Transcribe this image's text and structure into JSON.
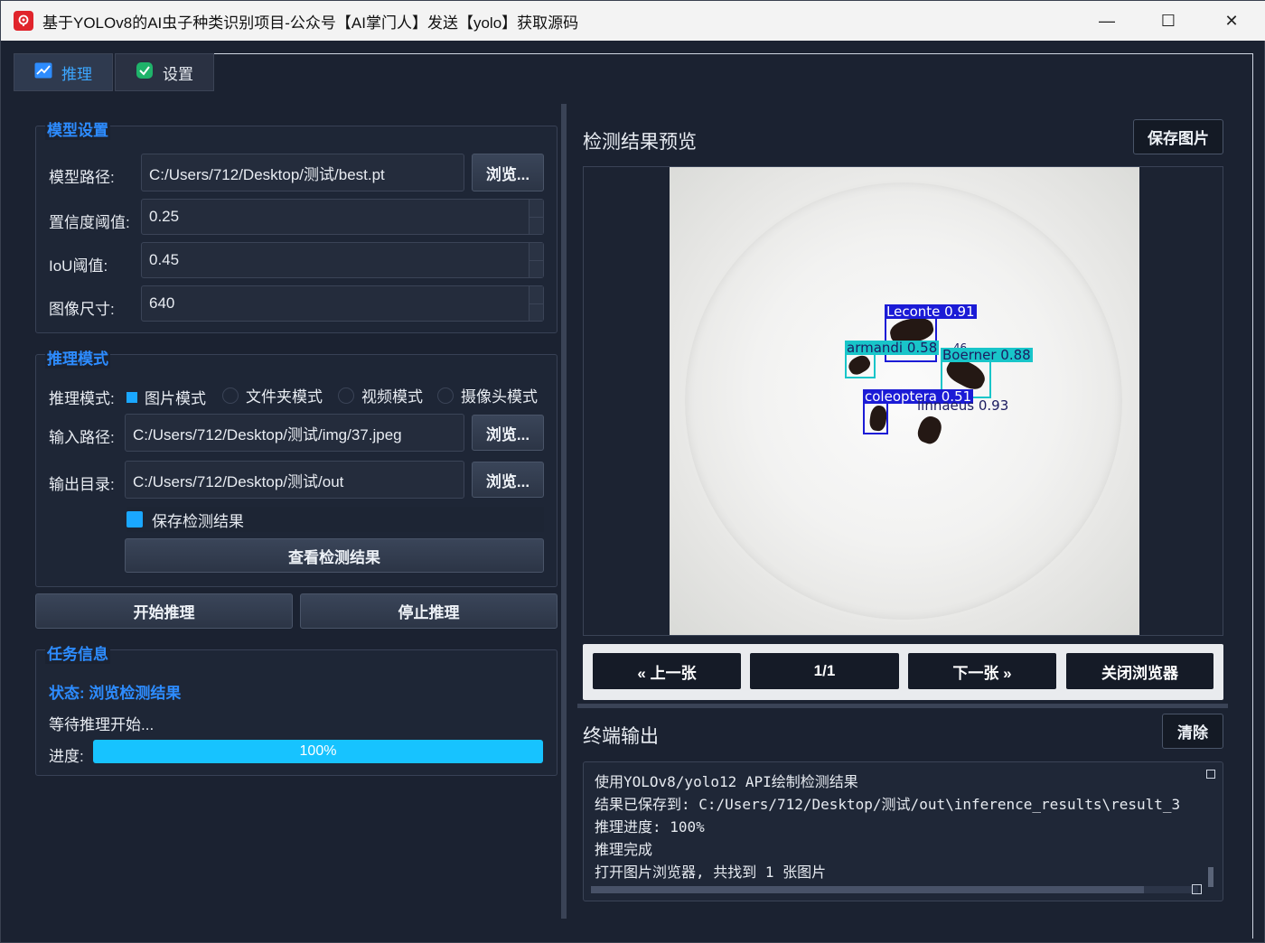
{
  "window": {
    "title": "基于YOLOv8的AI虫子种类识别项目-公众号【AI掌门人】发送【yolo】获取源码",
    "minimize_glyph": "—",
    "maximize_glyph": "☐",
    "close_glyph": "✕"
  },
  "tabs": [
    {
      "label": "推理",
      "icon": "chart-line-icon",
      "active": true
    },
    {
      "label": "设置",
      "icon": "check-shield-icon",
      "active": false
    }
  ],
  "model_settings": {
    "title": "模型设置",
    "model_path_label": "模型路径:",
    "model_path_value": "C:/Users/712/Desktop/测试/best.pt",
    "browse_label": "浏览...",
    "confidence_label": "置信度阈值:",
    "confidence_value": "0.25",
    "iou_label": "IoU阈值:",
    "iou_value": "0.45",
    "imgsz_label": "图像尺寸:",
    "imgsz_value": "640"
  },
  "inference_mode": {
    "title": "推理模式",
    "mode_label": "推理模式:",
    "options": [
      {
        "label": "图片模式",
        "selected": true
      },
      {
        "label": "文件夹模式",
        "selected": false
      },
      {
        "label": "视频模式",
        "selected": false
      },
      {
        "label": "摄像头模式",
        "selected": false
      }
    ],
    "input_label": "输入路径:",
    "input_value": "C:/Users/712/Desktop/测试/img/37.jpeg",
    "output_label": "输出目录:",
    "output_value": "C:/Users/712/Desktop/测试/out",
    "browse_label": "浏览...",
    "save_results_label": "保存检测结果",
    "save_results_checked": true,
    "view_results_label": "查看检测结果"
  },
  "actions": {
    "start_label": "开始推理",
    "stop_label": "停止推理"
  },
  "task_info": {
    "title": "任务信息",
    "status": "状态: 浏览检测结果",
    "message": "等待推理开始...",
    "progress_label": "进度:",
    "progress_text": "100%",
    "progress_value": 1.0
  },
  "preview": {
    "title": "检测结果预览",
    "save_image_label": "保存图片",
    "detections": [
      {
        "label": "Leconte  0.91",
        "color": "#1b1bd6"
      },
      {
        "label": "armandi  0.58",
        "color": "#19c5c9"
      },
      {
        "label": "Boerner  0.88",
        "color": "#19c5c9"
      },
      {
        "label": "coleoptera  0.51",
        "color": "#1b1bd6"
      },
      {
        "label": "linnaeus  0.93",
        "color": "#1b1bd6"
      }
    ],
    "overlap_fragment": ".46"
  },
  "navigation": {
    "prev_label": "« 上一张",
    "counter": "1/1",
    "next_label": "下一张 »",
    "close_label": "关闭浏览器"
  },
  "terminal": {
    "title": "终端输出",
    "clear_label": "清除",
    "lines": [
      "使用YOLOv8/yolo12 API绘制检测结果",
      "结果已保存到: C:/Users/712/Desktop/测试/out\\inference_results\\result_3",
      "推理进度: 100%",
      "推理完成",
      "打开图片浏览器, 共找到 1 张图片"
    ]
  }
}
